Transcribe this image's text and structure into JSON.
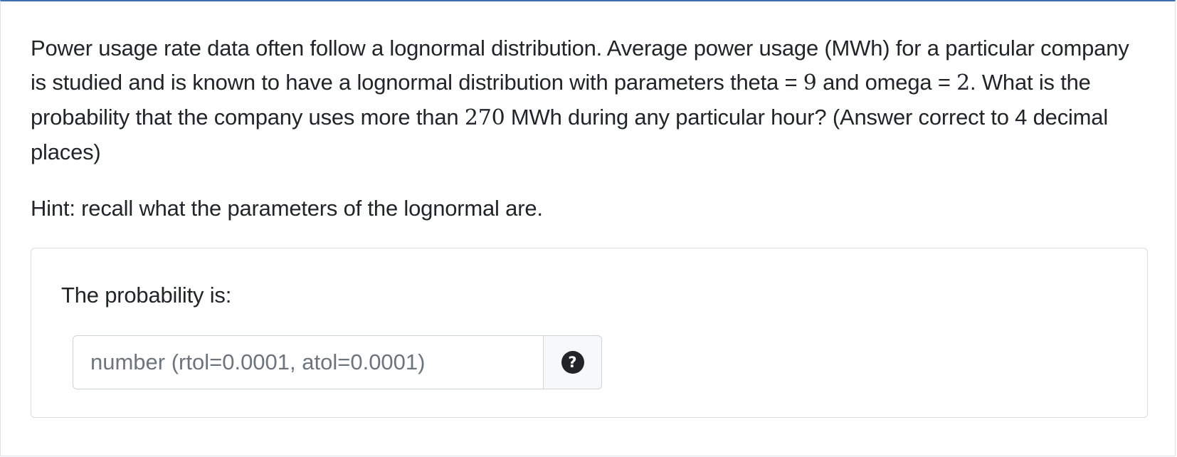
{
  "question": {
    "part1": "Power usage rate data often follow a lognormal distribution. Average power usage (MWh) for a particular company is studied and is known to have a lognormal distribution with parameters theta = ",
    "theta": "9",
    "part2": " and omega = ",
    "omega": "2",
    "part3": ". What is the probability that the company uses more than ",
    "threshold": "270",
    "part4": " MWh during any particular hour? (Answer correct to 4 decimal places)"
  },
  "hint": "Hint: recall what the parameters of the lognormal are.",
  "answer": {
    "label": "The probability is:",
    "input_value": "",
    "input_placeholder": "number (rtol=0.0001, atol=0.0001)",
    "help_icon": "question-circle-icon",
    "help_glyph": "?"
  },
  "colors": {
    "top_border_accent": "#3c6fb4",
    "text": "#212529",
    "placeholder": "#6c757d",
    "border": "#ced4da"
  }
}
